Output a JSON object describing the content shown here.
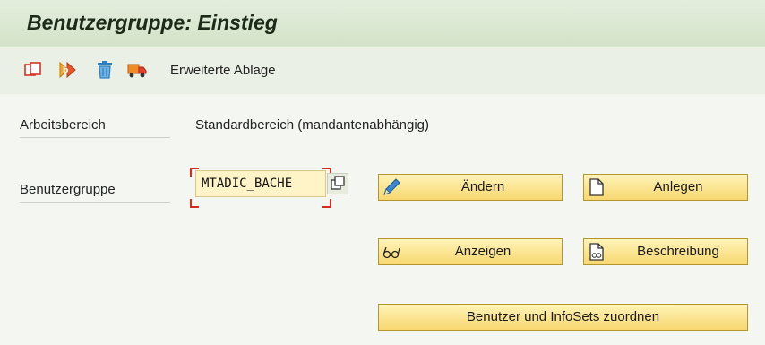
{
  "window": {
    "title": "Benutzergruppe: Einstieg"
  },
  "toolbar": {
    "icons": [
      "copy-icon",
      "execute-icon",
      "delete-icon",
      "transport-icon"
    ],
    "text_button": "Erweiterte Ablage"
  },
  "form": {
    "workspace_label": "Arbeitsbereich",
    "workspace_value": "Standardbereich (mandantenabhängig)",
    "usergroup_label": "Benutzergruppe",
    "usergroup_value": "MTADIC_BACHE"
  },
  "buttons": {
    "change": "Ändern",
    "create": "Anlegen",
    "display": "Anzeigen",
    "description": "Beschreibung",
    "assign": "Benutzer und InfoSets zuordnen"
  },
  "colors": {
    "title_bar": "#d3e2c8",
    "button_fill": "#f7d86f",
    "input_fill": "#fff4c8",
    "focus_marker": "#d62b1f"
  }
}
